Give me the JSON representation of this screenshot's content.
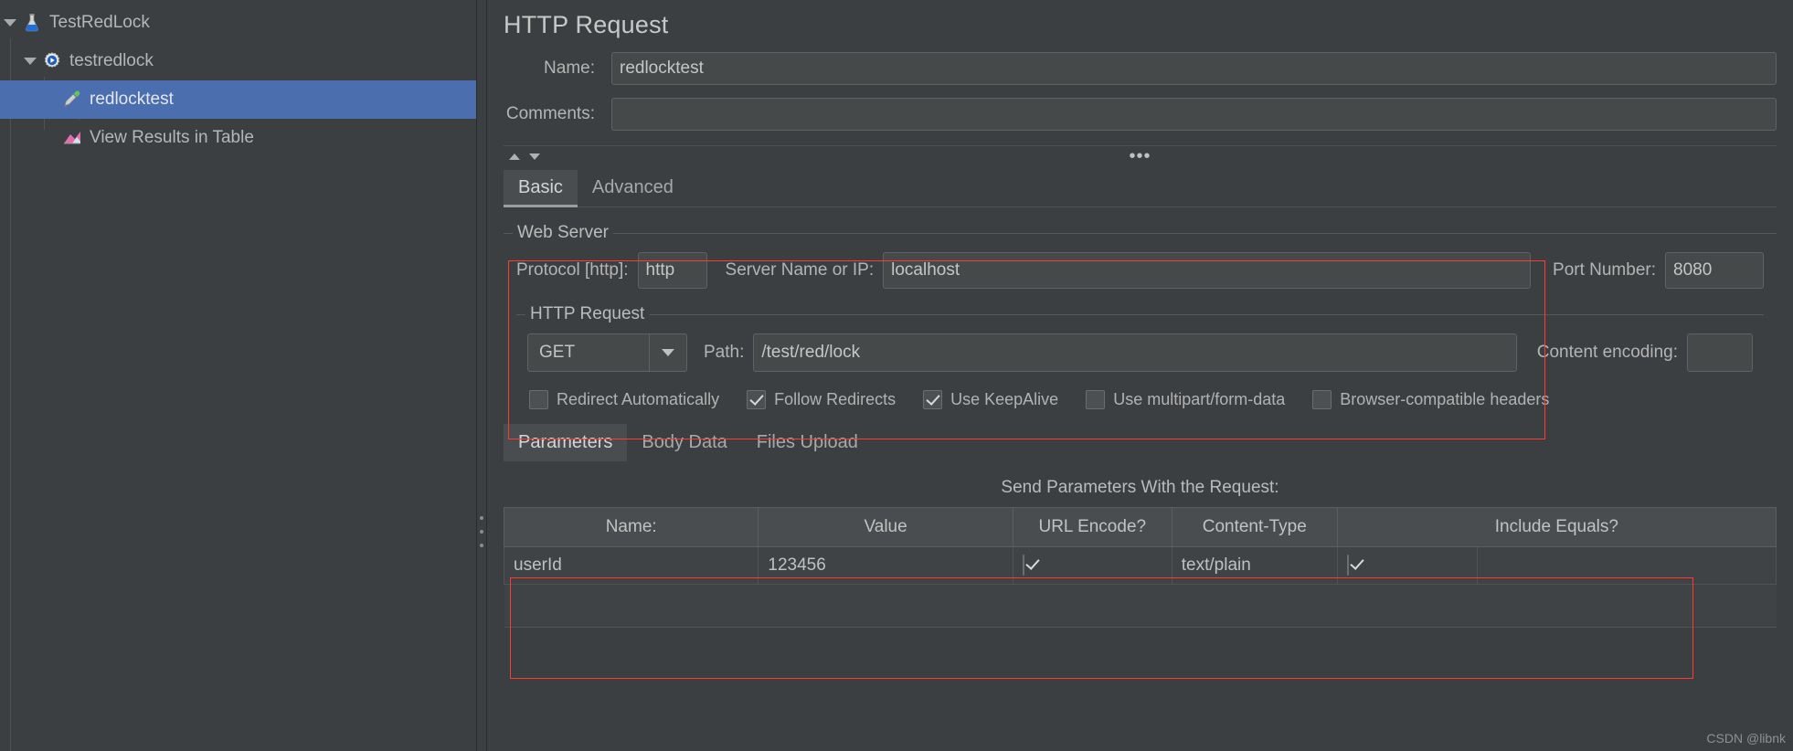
{
  "tree": {
    "items": [
      {
        "label": "TestRedLock",
        "icon": "flask-icon",
        "depth": 0,
        "expanded": true,
        "selected": false
      },
      {
        "label": "testredlock",
        "icon": "gear-play-icon",
        "depth": 1,
        "expanded": true,
        "selected": false
      },
      {
        "label": "redlocktest",
        "icon": "pipette-icon",
        "depth": 2,
        "expanded": false,
        "selected": true
      },
      {
        "label": "View Results in Table",
        "icon": "chart-icon",
        "depth": 2,
        "expanded": false,
        "selected": false
      }
    ]
  },
  "panel": {
    "title": "HTTP Request",
    "name_label": "Name:",
    "name_value": "redlocktest",
    "comments_label": "Comments:",
    "comments_value": "",
    "tabs": [
      {
        "label": "Basic",
        "active": true
      },
      {
        "label": "Advanced",
        "active": false
      }
    ],
    "web_server": {
      "title": "Web Server",
      "protocol_label": "Protocol [http]:",
      "protocol_value": "http",
      "server_label": "Server Name or IP:",
      "server_value": "localhost",
      "port_label": "Port Number:",
      "port_value": "8080"
    },
    "http_request": {
      "title": "HTTP Request",
      "method_value": "GET",
      "path_label": "Path:",
      "path_value": "/test/red/lock",
      "encoding_label": "Content encoding:",
      "encoding_value": ""
    },
    "options": [
      {
        "label": "Redirect Automatically",
        "checked": false
      },
      {
        "label": "Follow Redirects",
        "checked": true
      },
      {
        "label": "Use KeepAlive",
        "checked": true
      },
      {
        "label": "Use multipart/form-data",
        "checked": false
      },
      {
        "label": "Browser-compatible headers",
        "checked": false
      }
    ],
    "subtabs": [
      {
        "label": "Parameters",
        "active": true
      },
      {
        "label": "Body Data",
        "active": false
      },
      {
        "label": "Files Upload",
        "active": false
      }
    ],
    "params_caption": "Send Parameters With the Request:",
    "params_table": {
      "columns": [
        "Name:",
        "Value",
        "URL Encode?",
        "Content-Type",
        "Include Equals?"
      ],
      "rows": [
        {
          "name": "userId",
          "value": "123456",
          "url_encode": true,
          "content_type": "text/plain",
          "include_equals": true
        }
      ]
    }
  },
  "watermark": "CSDN @libnk",
  "colors": {
    "background": "#3c3f41",
    "selection": "#4b6eaf",
    "highlight_border": "#ff3b30",
    "field_background": "#45494a"
  }
}
